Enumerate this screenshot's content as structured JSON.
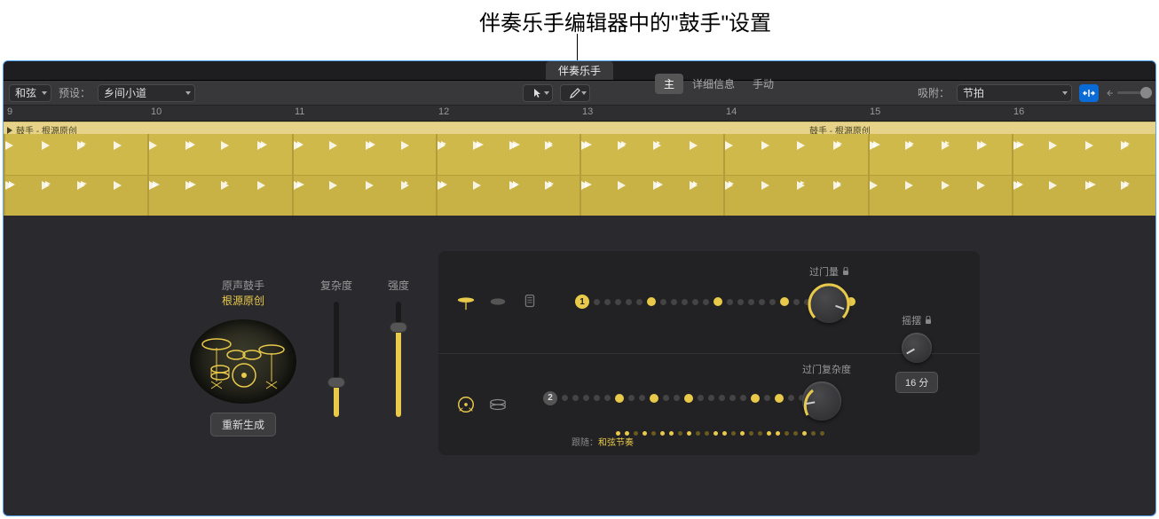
{
  "callout": "伴奏乐手编辑器中的\"鼓手\"设置",
  "title_tab": "伴奏乐手",
  "toolbar": {
    "chord_label": "和弦",
    "preset_label": "预设：",
    "preset_value": "乡间小道",
    "snap_label": "吸附：",
    "snap_value": "节拍"
  },
  "ruler": {
    "marks": [
      "9",
      "10",
      "11",
      "12",
      "13",
      "14",
      "15",
      "16"
    ]
  },
  "region": {
    "name_left": "鼓手 - 根源原创",
    "name_right": "鼓手 - 根源原创"
  },
  "kit": {
    "type_label": "原声鼓手",
    "style_label": "根源原创",
    "regen": "重新生成"
  },
  "sliders": {
    "complexity": "复杂度",
    "intensity": "强度"
  },
  "tabs": {
    "main": "主",
    "details": "详细信息",
    "manual": "手动"
  },
  "pattern": {
    "row1_num": "1",
    "row2_num": "2",
    "follow_label": "跟随：",
    "follow_value": "和弦节奏"
  },
  "knobs": {
    "fill_amount": "过门量",
    "fill_complexity": "过门复杂度",
    "swing": "摇摆",
    "swing_value": "16 分"
  }
}
